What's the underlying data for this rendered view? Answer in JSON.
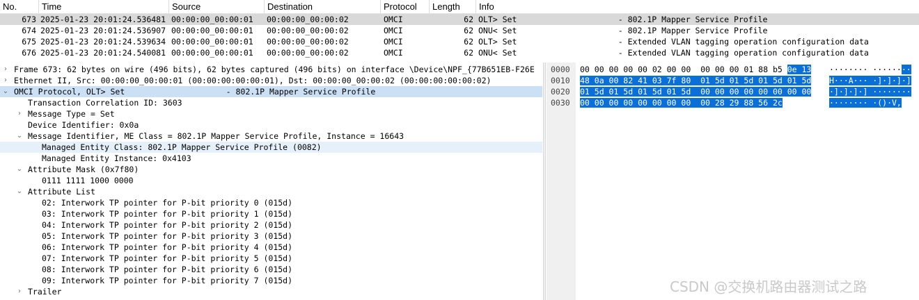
{
  "packet_list": {
    "columns": [
      "No.",
      "Time",
      "Source",
      "Destination",
      "Protocol",
      "Length",
      "Info"
    ],
    "rows": [
      {
        "no": "673",
        "time": "2025-01-23 20:01:24.536481",
        "src": "00:00:00_00:00:01",
        "dst": "00:00:00_00:00:02",
        "proto": "OMCI",
        "len": "62",
        "info": "OLT> Set                     - 802.1P Mapper Service Profile"
      },
      {
        "no": "674",
        "time": "2025-01-23 20:01:24.536907",
        "src": "00:00:00_00:00:01",
        "dst": "00:00:00_00:00:02",
        "proto": "OMCI",
        "len": "62",
        "info": "ONU< Set                     - 802.1P Mapper Service Profile"
      },
      {
        "no": "675",
        "time": "2025-01-23 20:01:24.539634",
        "src": "00:00:00_00:00:01",
        "dst": "00:00:00_00:00:02",
        "proto": "OMCI",
        "len": "62",
        "info": "OLT> Set                     - Extended VLAN tagging operation configuration data"
      },
      {
        "no": "676",
        "time": "2025-01-23 20:01:24.540081",
        "src": "00:00:00_00:00:01",
        "dst": "00:00:00_00:00:02",
        "proto": "OMCI",
        "len": "62",
        "info": "ONU< Set                     - Extended VLAN tagging operation configuration data"
      }
    ]
  },
  "details": {
    "rows": [
      {
        "text": "Frame 673: 62 bytes on wire (496 bits), 62 bytes captured (496 bits) on interface \\Device\\NPF_{77B651EB-F26E",
        "arrow": "›"
      },
      {
        "text": "Ethernet II, Src: 00:00:00_00:00:01 (00:00:00:00:00:01), Dst: 00:00:00_00:00:02 (00:00:00:00:00:02)",
        "arrow": "›"
      },
      {
        "text": "OMCI Protocol, OLT> Set                     - 802.1P Mapper Service Profile",
        "arrow": "⌄"
      },
      {
        "text": "Transaction Correlation ID: 3603",
        "arrow": ""
      },
      {
        "text": "Message Type = Set",
        "arrow": "›"
      },
      {
        "text": "Device Identifier: 0x0a",
        "arrow": ""
      },
      {
        "text": "Message Identifier, ME Class = 802.1P Mapper Service Profile, Instance = 16643",
        "arrow": "⌄"
      },
      {
        "text": "Managed Entity Class: 802.1P Mapper Service Profile (0082)",
        "arrow": ""
      },
      {
        "text": "Managed Entity Instance: 0x4103",
        "arrow": ""
      },
      {
        "text": "Attribute Mask (0x7f80)",
        "arrow": "⌄"
      },
      {
        "text": "0111 1111 1000 0000",
        "arrow": ""
      },
      {
        "text": "Attribute List",
        "arrow": "⌄"
      },
      {
        "text": "02: Interwork TP pointer for P-bit priority 0 (015d)",
        "arrow": ""
      },
      {
        "text": "03: Interwork TP pointer for P-bit priority 1 (015d)",
        "arrow": ""
      },
      {
        "text": "04: Interwork TP pointer for P-bit priority 2 (015d)",
        "arrow": ""
      },
      {
        "text": "05: Interwork TP pointer for P-bit priority 3 (015d)",
        "arrow": ""
      },
      {
        "text": "06: Interwork TP pointer for P-bit priority 4 (015d)",
        "arrow": ""
      },
      {
        "text": "07: Interwork TP pointer for P-bit priority 5 (015d)",
        "arrow": ""
      },
      {
        "text": "08: Interwork TP pointer for P-bit priority 6 (015d)",
        "arrow": ""
      },
      {
        "text": "09: Interwork TP pointer for P-bit priority 7 (015d)",
        "arrow": ""
      },
      {
        "text": "Trailer",
        "arrow": "›"
      }
    ]
  },
  "bytes": {
    "rows": [
      {
        "offset": "0000",
        "hex_plain": "00 00 00 00 00 02 00 00  00 00 00 01 88 b5 ",
        "hex_hl": "0e 13",
        "ascii_plain": "········ ······",
        "ascii_hl": "··"
      },
      {
        "offset": "0010",
        "hex_plain": "",
        "hex_hl": "48 0a 00 82 41 03 7f 80  01 5d 01 5d 01 5d 01 5d",
        "ascii_plain": "",
        "ascii_hl": "H···A··· ·]·]·]·]"
      },
      {
        "offset": "0020",
        "hex_plain": "",
        "hex_hl": "01 5d 01 5d 01 5d 01 5d  00 00 00 00 00 00 00 00",
        "ascii_plain": "",
        "ascii_hl": "·]·]·]·] ········"
      },
      {
        "offset": "0030",
        "hex_plain": "",
        "hex_hl": "00 00 00 00 00 00 00 00  00 28 29 88 56 2c",
        "ascii_plain": "",
        "ascii_hl": "········ ·()·V,"
      }
    ]
  },
  "watermark": "CSDN @交换机路由器测试之路",
  "colors": {
    "selection": "#cce0f5",
    "bytes_highlight": "#0a6fd6",
    "row_selected": "#d9d9d9"
  }
}
